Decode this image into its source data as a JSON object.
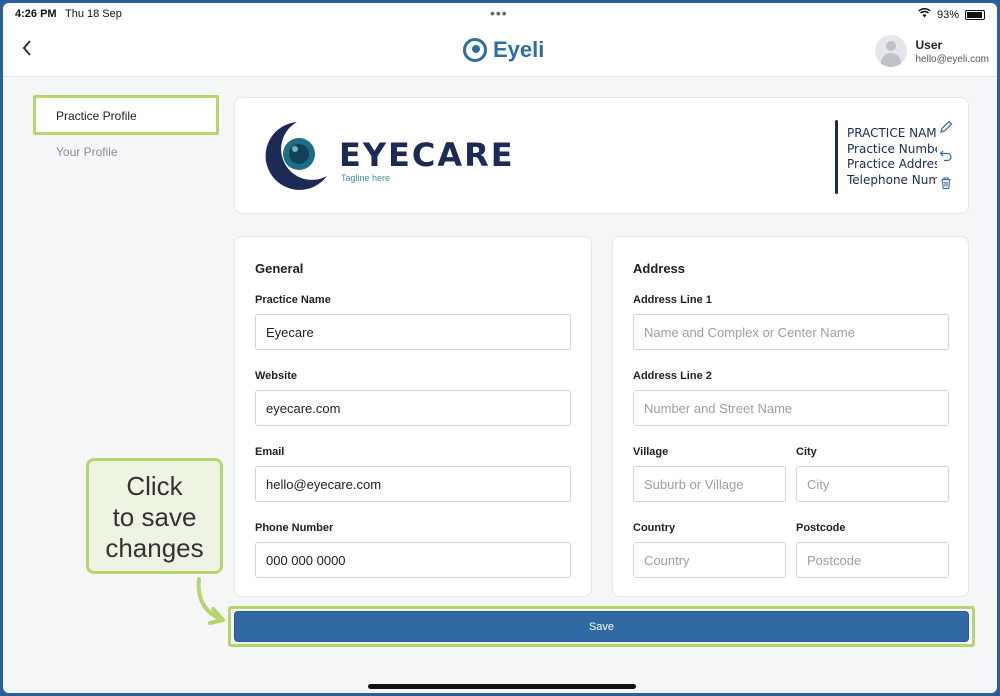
{
  "status_bar": {
    "time": "4:26 PM",
    "date": "Thu 18 Sep",
    "battery": "93%"
  },
  "header": {
    "brand": "Eyeli",
    "user_name": "User",
    "user_email": "hello@eyeli.com"
  },
  "nav": {
    "items": [
      {
        "label": "Practice Profile",
        "active": true
      },
      {
        "label": "Your Profile",
        "active": false
      }
    ]
  },
  "practice_logo": {
    "brand_text": "EYECARE",
    "tagline": "Tagline here",
    "info_lines": [
      "PRACTICE NAME",
      "Practice Number",
      "Practice Address",
      "Telephone Number"
    ]
  },
  "general": {
    "title": "General",
    "practice_name": {
      "label": "Practice Name",
      "value": "Eyecare"
    },
    "website": {
      "label": "Website",
      "value": "eyecare.com"
    },
    "email": {
      "label": "Email",
      "value": "hello@eyecare.com"
    },
    "phone": {
      "label": "Phone Number",
      "value": "000 000 0000"
    }
  },
  "address": {
    "title": "Address",
    "line1": {
      "label": "Address Line 1",
      "placeholder": "Name and Complex or Center Name"
    },
    "line2": {
      "label": "Address Line 2",
      "placeholder": "Number and Street Name"
    },
    "village": {
      "label": "Village",
      "placeholder": "Suburb or Village"
    },
    "city": {
      "label": "City",
      "placeholder": "City"
    },
    "country": {
      "label": "Country",
      "placeholder": "Country"
    },
    "postcode": {
      "label": "Postcode",
      "placeholder": "Postcode"
    }
  },
  "callout": {
    "lines": [
      "Click",
      "to save",
      "changes"
    ]
  },
  "save_label": "Save",
  "colors": {
    "accent": "#2f6aa3",
    "highlight": "#b5d66b",
    "logo_navy": "#1c2b55"
  }
}
